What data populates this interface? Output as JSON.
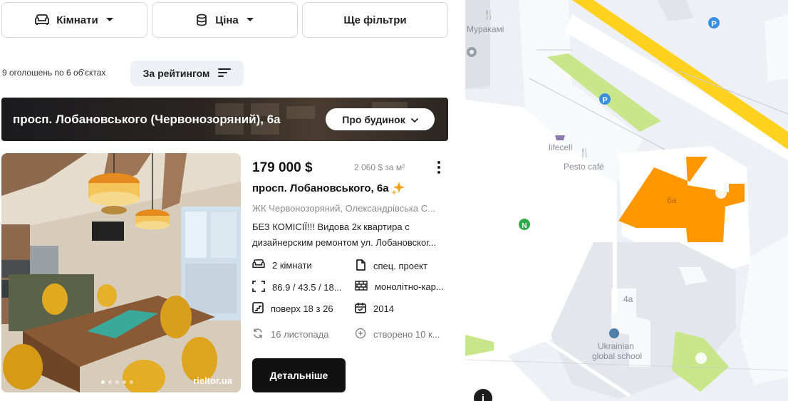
{
  "filters": {
    "rooms_label": "Кімнати",
    "price_label": "Ціна",
    "more_label": "Ще фільтри"
  },
  "results": {
    "count_text": "9 оголошень по 6 об'єктах",
    "sort_label": "За рейтингом"
  },
  "building": {
    "title": "просп. Лобановського (Червонозоряний), 6а",
    "about_label": "Про будинок"
  },
  "listing": {
    "price": "179 000 $",
    "price_per_m2": "2 060 $ за м²",
    "address": "просп. Лобановського, 6а",
    "complex": "ЖК Червонозоряний, Олександрівська С...",
    "description_line1": "БЕЗ КОМІСІЇ!!! Видова 2к квартира с",
    "description_line2": "дизайнерским ремонтом ул. Лобановског...",
    "watermark": "rieltor.ua",
    "photo_count": 5,
    "features": {
      "rooms": "2 кімнати",
      "project": "спец. проект",
      "area": "86.9 / 43.5 / 18...",
      "material": "монолітно-кар...",
      "floor": "поверх 18 з 26",
      "year": "2014",
      "updated": "16 листопада",
      "created": "створено 10 к..."
    },
    "details_label": "Детальніше"
  },
  "map": {
    "labels": {
      "murakami": "Муракамі",
      "lifecell": "lifecell",
      "pesto": "Pesto café",
      "building_6a": "6а",
      "building_4a": "4а",
      "school_line1": "Ukrainian",
      "school_line2": "global school",
      "info": "i"
    },
    "colors": {
      "highlight_building": "#ff9800",
      "road": "#ffd21f",
      "park": "#c8e68a",
      "parking": "#3b8fe0",
      "metro": "#2eaa4a",
      "food": "#e07a2b",
      "school": "#4f7fa6"
    }
  }
}
